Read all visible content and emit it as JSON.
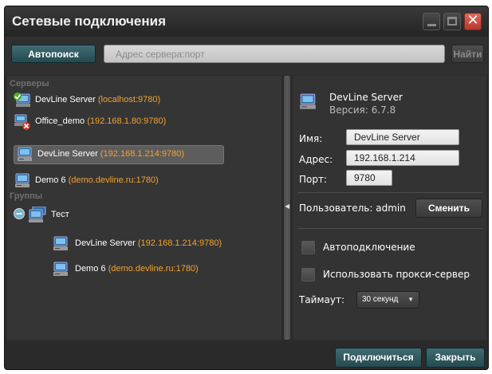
{
  "window": {
    "title": "Сетевые подключения"
  },
  "toolbar": {
    "autosearch_label": "Автопоиск",
    "address_placeholder": "Адрес сервера:порт",
    "address_value": "",
    "find_label": "Найти"
  },
  "servers": {
    "section_label": "Серверы",
    "items": [
      {
        "name": "DevLine Server",
        "address": "(localhost:9780)",
        "status": "connected-icon"
      },
      {
        "name": "Office_demo",
        "address": "(192.168.1.80:9780)",
        "status": "error-icon"
      },
      {
        "name": "DevLine Server",
        "address": "(192.168.1.214:9780)",
        "status": "server-icon"
      },
      {
        "name": "Demo 6",
        "address": "(demo.devline.ru:1780)",
        "status": "server-icon"
      }
    ]
  },
  "groups": {
    "section_label": "Группы",
    "group_name": "Тест",
    "items": [
      {
        "name": "DevLine Server",
        "address": "(192.168.1.214:9780)"
      },
      {
        "name": "Demo 6",
        "address": "(demo.devline.ru:1780)"
      }
    ]
  },
  "details": {
    "server_title": "DevLine Server",
    "version": "Версия: 6.7.8",
    "name_label": "Имя:",
    "name_value": "DevLine Server",
    "address_label": "Адрес:",
    "address_value": "192.168.1.214",
    "port_label": "Порт:",
    "port_value": "9780",
    "user_label": "Пользователь: admin",
    "change_label": "Сменить",
    "autoconnect_label": "Автоподключение",
    "proxy_label": "Использовать прокси-сервер",
    "timeout_label": "Таймаут:",
    "timeout_value": "30 секунд"
  },
  "footer": {
    "connect_label": "Подключиться",
    "close_label": "Закрыть"
  },
  "colors": {
    "accent": "#2f5a60",
    "address_text": "#f1a232",
    "window_bg": "#2c2c2c",
    "close_button": "#c9473a"
  }
}
